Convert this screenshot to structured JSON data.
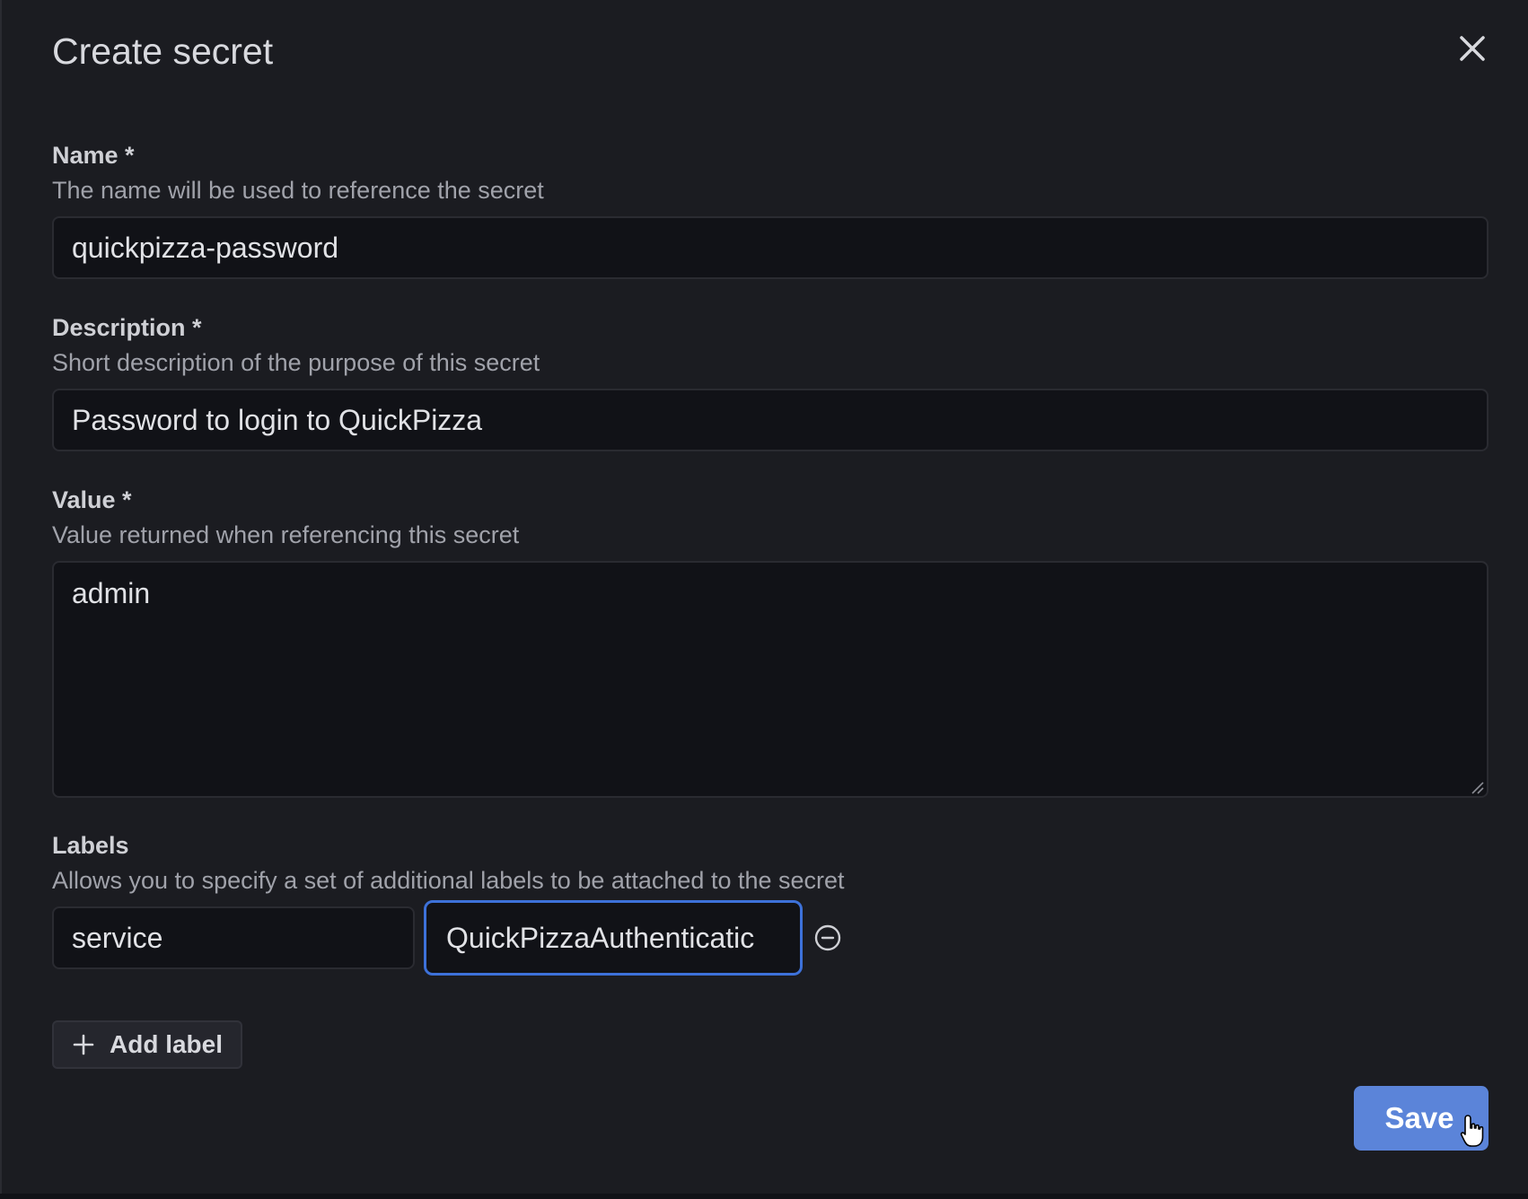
{
  "dialog": {
    "title": "Create secret",
    "close_icon": "close-icon"
  },
  "name": {
    "label": "Name *",
    "description": "The name will be used to reference the secret",
    "value": "quickpizza-password"
  },
  "description": {
    "label": "Description *",
    "description": "Short description of the purpose of this secret",
    "value": "Password to login to QuickPizza"
  },
  "value": {
    "label": "Value *",
    "description": "Value returned when referencing this secret",
    "value": "admin"
  },
  "labels": {
    "label": "Labels",
    "description": "Allows you to specify a set of additional labels to be attached to the secret",
    "items": [
      {
        "key": "service",
        "value": "QuickPizzaAuthenticatic"
      }
    ],
    "remove_icon": "minus-circle-icon",
    "add_label": "Add label",
    "add_icon": "plus-icon"
  },
  "footer": {
    "save_label": "Save"
  },
  "colors": {
    "accent": "#3d71d9",
    "primary_button": "#5b84d9",
    "background": "#1b1c21"
  }
}
